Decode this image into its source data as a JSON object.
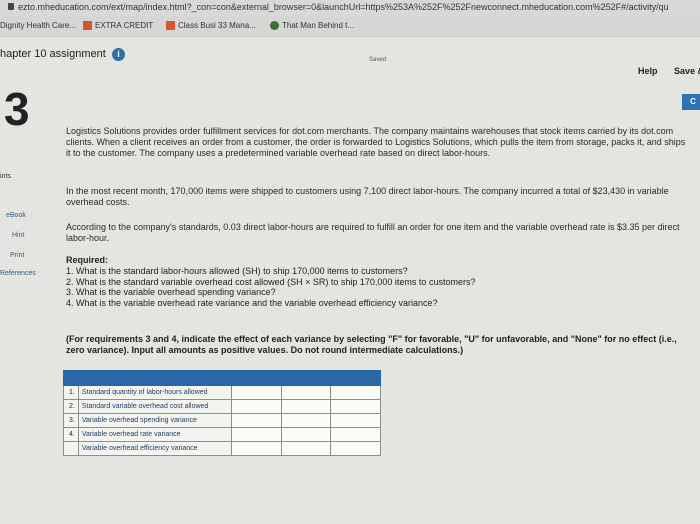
{
  "browser": {
    "url": "ezto.mheducation.com/ext/map/index.html?_con=con&external_browser=0&launchUrl=https%253A%252F%252Fnewconnect.mheducation.com%252F#/activity/qu",
    "bookmarks": [
      "Dignity Health Care...",
      "EXTRA CREDIT",
      "Class Busi 33 Mana...",
      "That Man Behind t..."
    ]
  },
  "header": {
    "title": "hapter 10 assignment",
    "saved": "Saved",
    "help": "Help",
    "save_exit": "Save &",
    "check": "C"
  },
  "sidebar": {
    "question_number": "3",
    "points_label": "ints",
    "links": [
      "eBook",
      "Hint",
      "Print",
      "References"
    ]
  },
  "problem": {
    "p1": "Logistics Solutions provides order fulfillment services for dot.com merchants. The company maintains warehouses that stock items carried by its dot.com clients. When a client receives an order from a customer, the order is forwarded to Logistics Solutions, which pulls the item from storage, packs it, and ships it to the customer. The company uses a predetermined variable overhead rate based on direct labor-hours.",
    "p2": "In the most recent month, 170,000 items were shipped to customers using 7,100 direct labor-hours. The company incurred a total of $23,430 in variable overhead costs.",
    "p3": "According to the company's standards, 0.03 direct labor-hours are required to fulfill an order for one item and the variable overhead rate is $3.35 per direct labor-hour.",
    "required_title": "Required:",
    "required": [
      "1. What is the standard labor-hours allowed (SH) to ship 170,000 items to customers?",
      "2. What is the standard variable overhead cost allowed (SH × SR) to ship 170,000 items to customers?",
      "3. What is the variable overhead spending variance?",
      "4. What is the variable overhead rate variance and the variable overhead efficiency variance?"
    ],
    "instructions": "(For requirements 3 and 4, indicate the effect of each variance by selecting \"F\" for favorable, \"U\" for unfavorable, and \"None\" for no effect (i.e., zero variance). Input all amounts as positive values. Do not round intermediate calculations.)"
  },
  "table": {
    "rows": [
      {
        "num": "1.",
        "label": "Standard quantity of labor-hours allowed"
      },
      {
        "num": "2.",
        "label": "Standard variable overhead cost allowed"
      },
      {
        "num": "3.",
        "label": "Variable overhead spending variance"
      },
      {
        "num": "4.",
        "label": "Variable overhead rate variance"
      },
      {
        "num": "",
        "label": "Variable overhead efficiency variance"
      }
    ]
  },
  "colors": {
    "accent": "#2a67a6",
    "check": "#2e72b3"
  }
}
